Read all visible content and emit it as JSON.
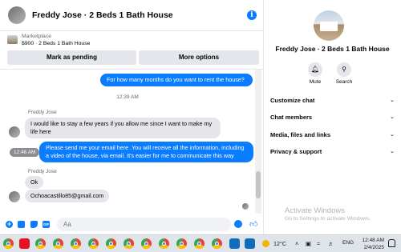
{
  "conversation": {
    "title": "Freddy Jose · 2 Beds 1 Bath House",
    "marketplace": {
      "label": "Marketplace",
      "listing": "$900 · 2 Beds 1 Bath House",
      "mark_pending": "Mark as pending",
      "more_options": "More options"
    },
    "messages": [
      {
        "direction": "out",
        "text": "For how many months do you want to rent the house?"
      },
      {
        "direction": "timestamp",
        "text": "12:39 AM"
      },
      {
        "direction": "in",
        "sender": "Freddy Jose",
        "text": "I would like to stay a few years if you allow me since I want to make my life here"
      },
      {
        "direction": "out",
        "time": "12:46 AM",
        "text": "Please send me your email here .You will receive all the information, including a video of the house, via email. It's easier for me to communicate this way"
      },
      {
        "direction": "in",
        "sender": "Freddy Jose",
        "text": "Ok"
      },
      {
        "direction": "in",
        "text": "Ochoacastillo85@gmail.com"
      }
    ],
    "composer": {
      "placeholder": "Aa"
    }
  },
  "details": {
    "name": "Freddy Jose · 2 Beds 1 Bath House",
    "actions": [
      {
        "label": "Mute",
        "icon": "bell-icon"
      },
      {
        "label": "Search",
        "icon": "search-icon"
      }
    ],
    "sections": [
      "Customize chat",
      "Chat members",
      "Media, files and links",
      "Privacy & support"
    ]
  },
  "watermark": {
    "title": "Activate Windows",
    "subtitle": "Go to Settings to activate Windows."
  },
  "taskbar": {
    "temperature": "12°C",
    "language": "ENG",
    "time": "12:48 AM",
    "date": "2/4/2025"
  },
  "colors": {
    "accent": "#0a7cff",
    "bubble_in": "#e4e6eb",
    "taskbar": "#dfe3ea"
  }
}
